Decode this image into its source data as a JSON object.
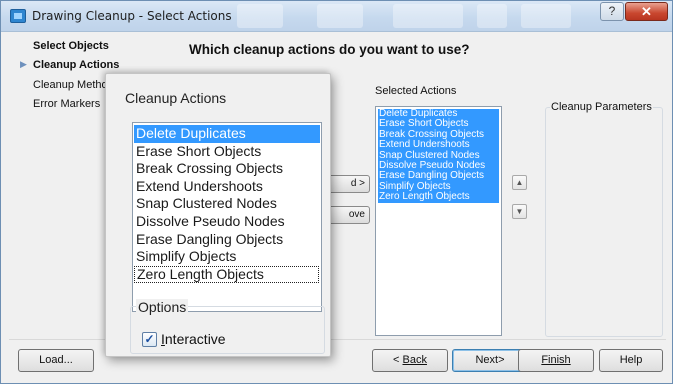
{
  "window": {
    "title": "Drawing Cleanup - Select Actions",
    "help_glyph": "?",
    "close_glyph": "✕"
  },
  "nav": {
    "items": [
      {
        "label": "Select Objects",
        "state": "done"
      },
      {
        "label": "Cleanup Actions",
        "state": "current"
      },
      {
        "label": "Cleanup Methods",
        "state": "pending"
      },
      {
        "label": "Error Markers",
        "state": "pending"
      }
    ]
  },
  "heading": "Which cleanup actions do you want to use?",
  "selected_actions": {
    "label": "Selected Actions",
    "items": [
      "Delete Duplicates",
      "Erase Short Objects",
      "Break Crossing Objects",
      "Extend Undershoots",
      "Snap Clustered Nodes",
      "Dissolve Pseudo Nodes",
      "Erase Dangling Objects",
      "Simplify Objects",
      "Zero Length Objects"
    ]
  },
  "cleanup_parameters": {
    "label": "Cleanup Parameters"
  },
  "middle_buttons": {
    "add_label": "d >",
    "remove_label": "ove"
  },
  "footer": {
    "load_label": "Load...",
    "back_label": "Back",
    "next_label": "Next>",
    "finish_label": "Finish",
    "help_label": "Help"
  },
  "zoom": {
    "title": "Cleanup Actions",
    "actions": [
      "Delete Duplicates",
      "Erase Short Objects",
      "Break Crossing Objects",
      "Extend Undershoots",
      "Snap Clustered Nodes",
      "Dissolve Pseudo Nodes",
      "Erase Dangling Objects",
      "Simplify Objects",
      "Zero Length Objects"
    ],
    "selected_index": 0,
    "focused_index": 8,
    "options_label": "Options",
    "interactive_label": "Interactive",
    "interactive_checked": true
  }
}
